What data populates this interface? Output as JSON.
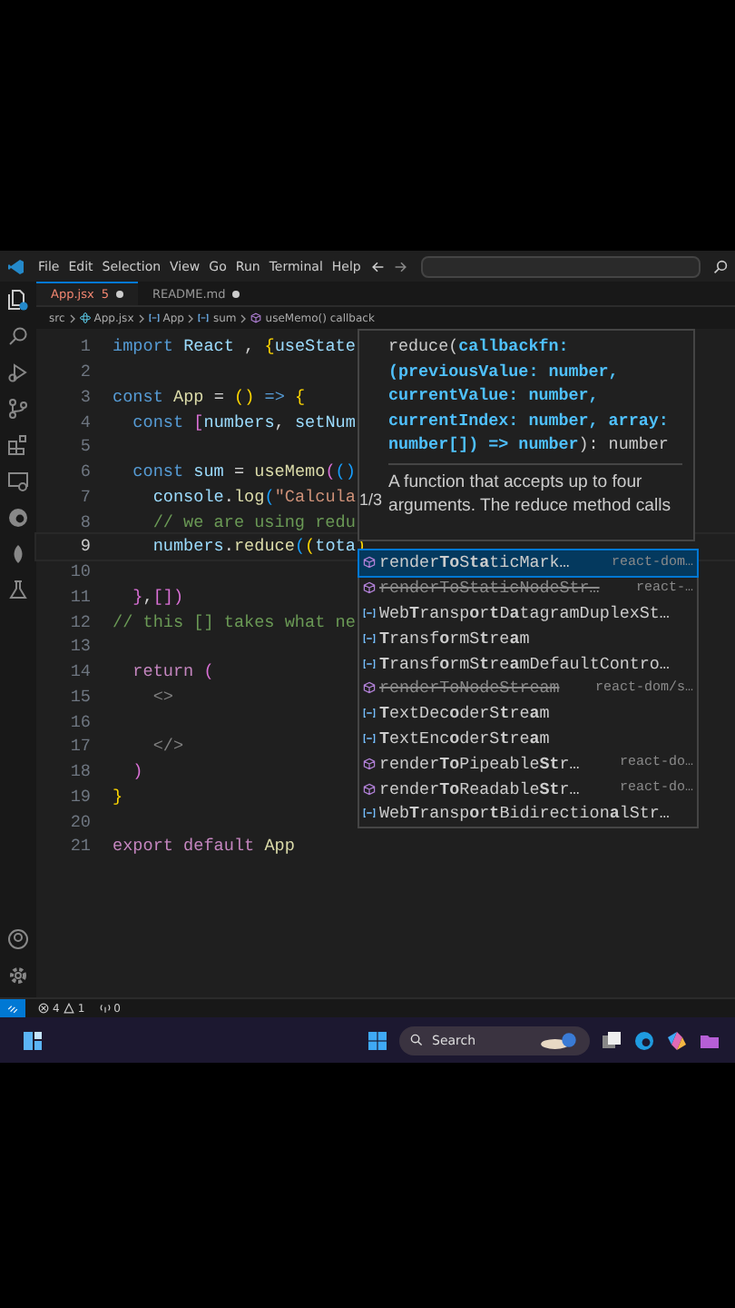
{
  "menu_bar": {
    "items": [
      "File",
      "Edit",
      "Selection",
      "View",
      "Go",
      "Run",
      "Terminal",
      "Help"
    ]
  },
  "tabs": [
    {
      "label": "App.jsx",
      "badge": "5",
      "modified": true,
      "selected": true
    },
    {
      "label": "README.md",
      "modified": true,
      "selected": false
    }
  ],
  "breadcrumb": [
    {
      "kind": "folder",
      "label": "src"
    },
    {
      "kind": "file",
      "label": "App.jsx"
    },
    {
      "kind": "variable",
      "label": "App"
    },
    {
      "kind": "variable",
      "label": "sum"
    },
    {
      "kind": "function",
      "label": "useMemo() callback"
    }
  ],
  "editor": {
    "lines": [
      {
        "number": "1",
        "active": false,
        "tokens": [
          {
            "t": "import",
            "kind": "keyword"
          },
          {
            "t": " React",
            "kind": "variable"
          },
          {
            "t": " , ",
            "kind": "punct"
          },
          {
            "t": "{",
            "kind": "bracket1"
          },
          {
            "t": "useState",
            "kind": "variable"
          }
        ]
      },
      {
        "number": "2",
        "active": false
      },
      {
        "number": "3",
        "active": false,
        "tokens": [
          {
            "t": "const",
            "kind": "keyword"
          },
          {
            "t": " App",
            "kind": "function"
          },
          {
            "t": " = ",
            "kind": "punct"
          },
          {
            "t": "()",
            "kind": "bracket1"
          },
          {
            "t": " => ",
            "kind": "keyword"
          },
          {
            "t": "{",
            "kind": "bracket1"
          }
        ]
      },
      {
        "number": "4",
        "active": false,
        "tokens": [
          {
            "t": "  const ",
            "kind": "keyword"
          },
          {
            "t": "[",
            "kind": "bracket2"
          },
          {
            "t": "numbers",
            "kind": "variable"
          },
          {
            "t": ", ",
            "kind": "punct"
          },
          {
            "t": "setNum",
            "kind": "variable"
          }
        ]
      },
      {
        "number": "5",
        "active": false
      },
      {
        "number": "6",
        "active": false,
        "tokens": [
          {
            "t": "  const",
            "kind": "keyword"
          },
          {
            "t": " sum",
            "kind": "variable"
          },
          {
            "t": " = ",
            "kind": "punct"
          },
          {
            "t": "useMemo",
            "kind": "function"
          },
          {
            "t": "(",
            "kind": "bracket2"
          },
          {
            "t": "()",
            "kind": "bracket3"
          }
        ]
      },
      {
        "number": "7",
        "active": false,
        "tokens": [
          {
            "t": "    console",
            "kind": "variable"
          },
          {
            "t": ".",
            "kind": "punct"
          },
          {
            "t": "log",
            "kind": "function"
          },
          {
            "t": "(",
            "kind": "bracket3"
          },
          {
            "t": "\"Calcula",
            "kind": "string"
          }
        ]
      },
      {
        "number": "8",
        "active": false,
        "tokens": [
          {
            "t": "    // we are using redu",
            "kind": "comment"
          }
        ]
      },
      {
        "number": "9",
        "active": true,
        "tokens": [
          {
            "t": "    numbers",
            "kind": "variable"
          },
          {
            "t": ".",
            "kind": "punct"
          },
          {
            "t": "reduce",
            "kind": "function"
          },
          {
            "t": "(",
            "kind": "bracket3"
          },
          {
            "t": "(",
            "kind": "bracket1"
          },
          {
            "t": "tota",
            "kind": "variable"
          },
          {
            "t": ")",
            "kind": "bracket1"
          }
        ]
      },
      {
        "number": "10",
        "active": false
      },
      {
        "number": "11",
        "active": false,
        "tokens": [
          {
            "t": "  }",
            "kind": "bracket2"
          },
          {
            "t": ",",
            "kind": "punct"
          },
          {
            "t": "[]",
            "kind": "bracket2"
          },
          {
            "t": ")",
            "kind": "bracket2"
          }
        ]
      },
      {
        "number": "12",
        "active": false,
        "tokens": [
          {
            "t": "// this [] takes what ne",
            "kind": "comment"
          }
        ]
      },
      {
        "number": "13",
        "active": false
      },
      {
        "number": "14",
        "active": false,
        "tokens": [
          {
            "t": "  return ",
            "kind": "control"
          },
          {
            "t": "(",
            "kind": "bracket2"
          }
        ]
      },
      {
        "number": "15",
        "active": false,
        "tokens": [
          {
            "t": "    <>",
            "kind": "tag"
          }
        ]
      },
      {
        "number": "16",
        "active": false
      },
      {
        "number": "17",
        "active": false,
        "tokens": [
          {
            "t": "    </>",
            "kind": "tag"
          }
        ]
      },
      {
        "number": "18",
        "active": false,
        "tokens": [
          {
            "t": "  )",
            "kind": "bracket2"
          }
        ]
      },
      {
        "number": "19",
        "active": false,
        "tokens": [
          {
            "t": "}",
            "kind": "bracket1"
          }
        ]
      },
      {
        "number": "20",
        "active": false
      },
      {
        "number": "21",
        "active": false,
        "tokens": [
          {
            "t": "export default ",
            "kind": "control"
          },
          {
            "t": "App",
            "kind": "function"
          }
        ]
      }
    ]
  },
  "hover": {
    "counter": "1/3",
    "signature": [
      [
        {
          "t": "reduce(",
          "kind": "plain"
        },
        {
          "t": "callbackfn:",
          "kind": "param"
        }
      ],
      [
        {
          "t": "(previousValue: number,",
          "kind": "param"
        }
      ],
      [
        {
          "t": "currentValue: number,",
          "kind": "param"
        }
      ],
      [
        {
          "t": "currentIndex: number, array:",
          "kind": "param"
        }
      ],
      [
        {
          "t": "number[]) => number",
          "kind": "param"
        },
        {
          "t": "): number",
          "kind": "plain"
        }
      ]
    ],
    "description": "A function that accepts up to four arguments. The reduce method calls"
  },
  "suggestions": [
    {
      "kind": "method",
      "label": "render**To**S**ta**ticMark…",
      "detail": "react-dom…",
      "deprecated": false,
      "selected": true
    },
    {
      "kind": "method",
      "label": "renderToStaticNodeStr…",
      "detail": "react-…",
      "deprecated": true,
      "selected": false
    },
    {
      "kind": "variable",
      "label": "Web**T**ransp**o**r**t**D**a**tagramDuplexSt…",
      "deprecated": false,
      "selected": false
    },
    {
      "kind": "variable",
      "label": "**T**ransf**o**rmS**t**re**a**m",
      "deprecated": false,
      "selected": false
    },
    {
      "kind": "variable",
      "label": "**T**ransf**o**rmS**t**re**a**mDefaultContro…",
      "deprecated": false,
      "selected": false
    },
    {
      "kind": "method",
      "label": "renderToNodeStream",
      "detail": "react-dom/s…",
      "deprecated": true,
      "selected": false
    },
    {
      "kind": "variable",
      "label": "**T**extDec**o**derS**t**re**a**m",
      "deprecated": false,
      "selected": false
    },
    {
      "kind": "variable",
      "label": "**T**extEnc**o**derS**t**re**a**m",
      "deprecated": false,
      "selected": false
    },
    {
      "kind": "method",
      "label": "render**To**Pipeable**St**r…",
      "detail": "react-do…",
      "deprecated": false,
      "selected": false
    },
    {
      "kind": "method",
      "label": "render**To**Readable**St**r…",
      "detail": "react-do…",
      "deprecated": false,
      "selected": false
    },
    {
      "kind": "variable",
      "label": "Web**T**ransp**o**r**t**Bidirection**a**lStr…",
      "deprecated": false,
      "selected": false
    }
  ],
  "status_bar": {
    "errors": "4",
    "warnings": "1",
    "ports": "0"
  },
  "taskbar": {
    "search_placeholder": "Search"
  }
}
